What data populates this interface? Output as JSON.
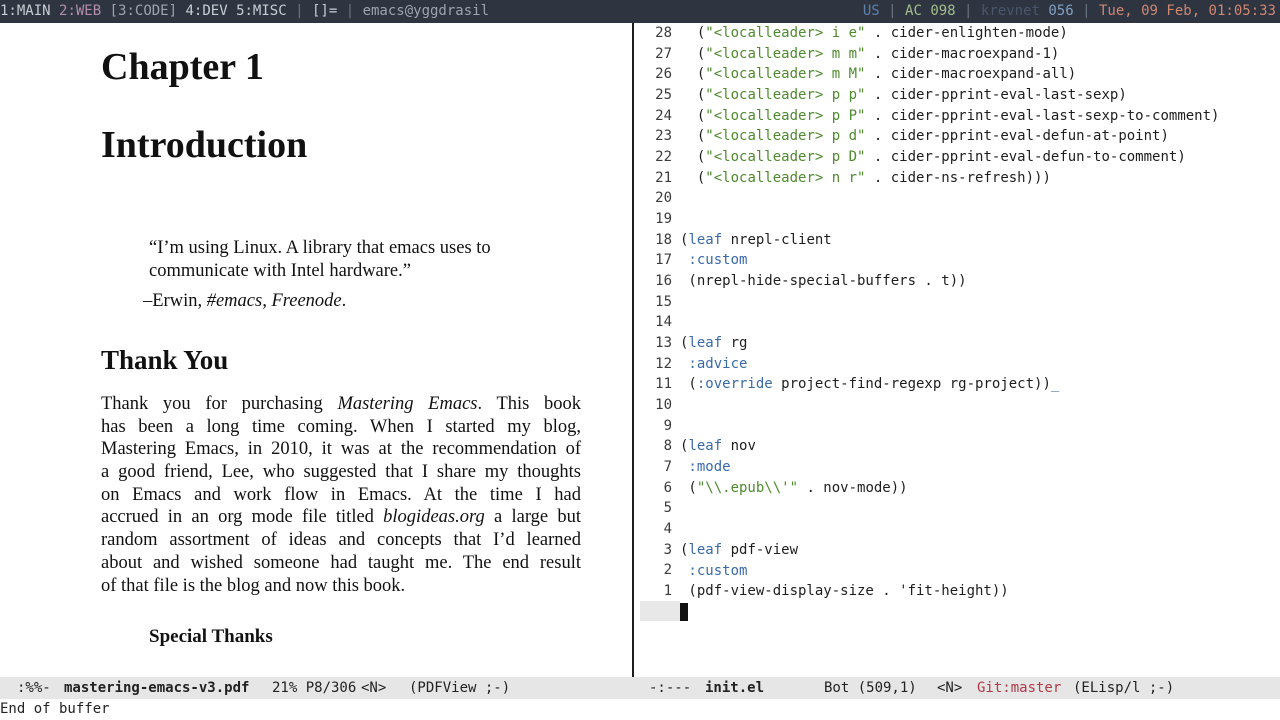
{
  "topbar": {
    "ws1": "1:MAIN",
    "ws2": "2:WEB",
    "ws3": "[3:CODE]",
    "ws4": "4:DEV",
    "ws5": "5:MISC",
    "sep1": "|",
    "layout": "[]=",
    "sep2": "|",
    "window_title": "emacs@yggdrasil",
    "kbd": "US",
    "sep3": "|",
    "battery": "AC 098",
    "sep4": "|",
    "net_label": "krevnet",
    "net_value": "056",
    "sep5": "|",
    "datetime": "Tue, 09 Feb, 01:05:33",
    "colors": {
      "bg": "#2e3440",
      "ws_active": "#9ca4b0",
      "ws_web": "#b48ead",
      "accent": "#88c0d0",
      "warn": "#d08770",
      "green": "#a3be8c"
    }
  },
  "pdf": {
    "chapter": "Chapter 1",
    "title": "Introduction",
    "quote_l1": "“I’m using Linux. A library that emacs uses to",
    "quote_l2": "communicate with Intel hardware.”",
    "attrib_pre": "–Erwin, ",
    "attrib_em": "#emacs, Freenode",
    "attrib_post": ".",
    "section": "Thank You",
    "para": {
      "l1a": "Thank you for purchasing ",
      "l1em": "Mastering Emacs",
      "l1b": ". This book",
      "l2": "has been a long time coming. When I started my blog,",
      "l3": "Mastering Emacs, in 2010, it was at the recommendation of",
      "l4": "a good friend, Lee, who suggested that I share my thoughts",
      "l5": "on Emacs and work flow in Emacs. At the time I had",
      "l6a": "accrued in an org mode file titled ",
      "l6em": "blogideas.org",
      "l6b": " a large but",
      "l7": "random assortment of ideas and concepts that I’d learned",
      "l8": "about and wished someone had taught me. The end result",
      "l9": "of that file is the blog and now this book."
    },
    "subsection": "Special Thanks"
  },
  "code": {
    "numbers": [
      "28",
      "27",
      "26",
      "25",
      "24",
      "23",
      "22",
      "21",
      "20",
      "19",
      "18",
      "17",
      "16",
      "15",
      "14",
      "13",
      "12",
      "11",
      "10",
      "9",
      "8",
      "7",
      "6",
      "5",
      "4",
      "3",
      "2",
      "1"
    ],
    "l28": {
      "pre": "  (",
      "s": "\"<localleader> i e\"",
      "post": " . cider-enlighten-mode)"
    },
    "l27": {
      "pre": "  (",
      "s": "\"<localleader> m m\"",
      "post": " . cider-macroexpand-1)"
    },
    "l26": {
      "pre": "  (",
      "s": "\"<localleader> m M\"",
      "post": " . cider-macroexpand-all)"
    },
    "l25": {
      "pre": "  (",
      "s": "\"<localleader> p p\"",
      "post": " . cider-pprint-eval-last-sexp)"
    },
    "l24": {
      "pre": "  (",
      "s": "\"<localleader> p P\"",
      "post": " . cider-pprint-eval-last-sexp-to-comment)"
    },
    "l23": {
      "pre": "  (",
      "s": "\"<localleader> p d\"",
      "post": " . cider-pprint-eval-defun-at-point)"
    },
    "l22": {
      "pre": "  (",
      "s": "\"<localleader> p D\"",
      "post": " . cider-pprint-eval-defun-to-comment)"
    },
    "l21": {
      "pre": "  (",
      "s": "\"<localleader> n r\"",
      "post": " . cider-ns-refresh)))"
    },
    "l18": {
      "pre": "(",
      "kw": "leaf",
      "post": " nrepl-client"
    },
    "l17": {
      "kw": " :custom"
    },
    "l16": {
      "text": " (nrepl-hide-special-buffers . t))"
    },
    "l13": {
      "pre": "(",
      "kw": "leaf",
      "post": " rg"
    },
    "l12": {
      "kw": " :advice"
    },
    "l11": {
      "pre": " (",
      "kw": ":override",
      "post": " project-find-regexp rg-project))",
      "tail": "_"
    },
    "l8": {
      "pre": "(",
      "kw": "leaf",
      "post": " nov"
    },
    "l7": {
      "kw": " :mode"
    },
    "l6": {
      "pre": " (",
      "s": "\"\\\\.epub\\\\'\"",
      "post": " . nov-mode))"
    },
    "l3": {
      "pre": "(",
      "kw": "leaf",
      "post": " pdf-view"
    },
    "l2": {
      "kw": " :custom"
    },
    "l1": {
      "text": " (pdf-view-display-size . 'fit-height))"
    }
  },
  "modeline": {
    "left_status": ":%%-",
    "left_buffer": "mastering-emacs-v3.pdf",
    "left_pos": "21% P8/306",
    "left_state": "<N>",
    "left_mode": "(PDFView ;-)",
    "right_status": "-:---",
    "right_buffer": "init.el",
    "right_pos": "Bot (509,1)",
    "right_state": "<N>",
    "right_vc": "Git:master",
    "right_mode": "(ELisp/l ;-)"
  },
  "echo": "End of buffer"
}
